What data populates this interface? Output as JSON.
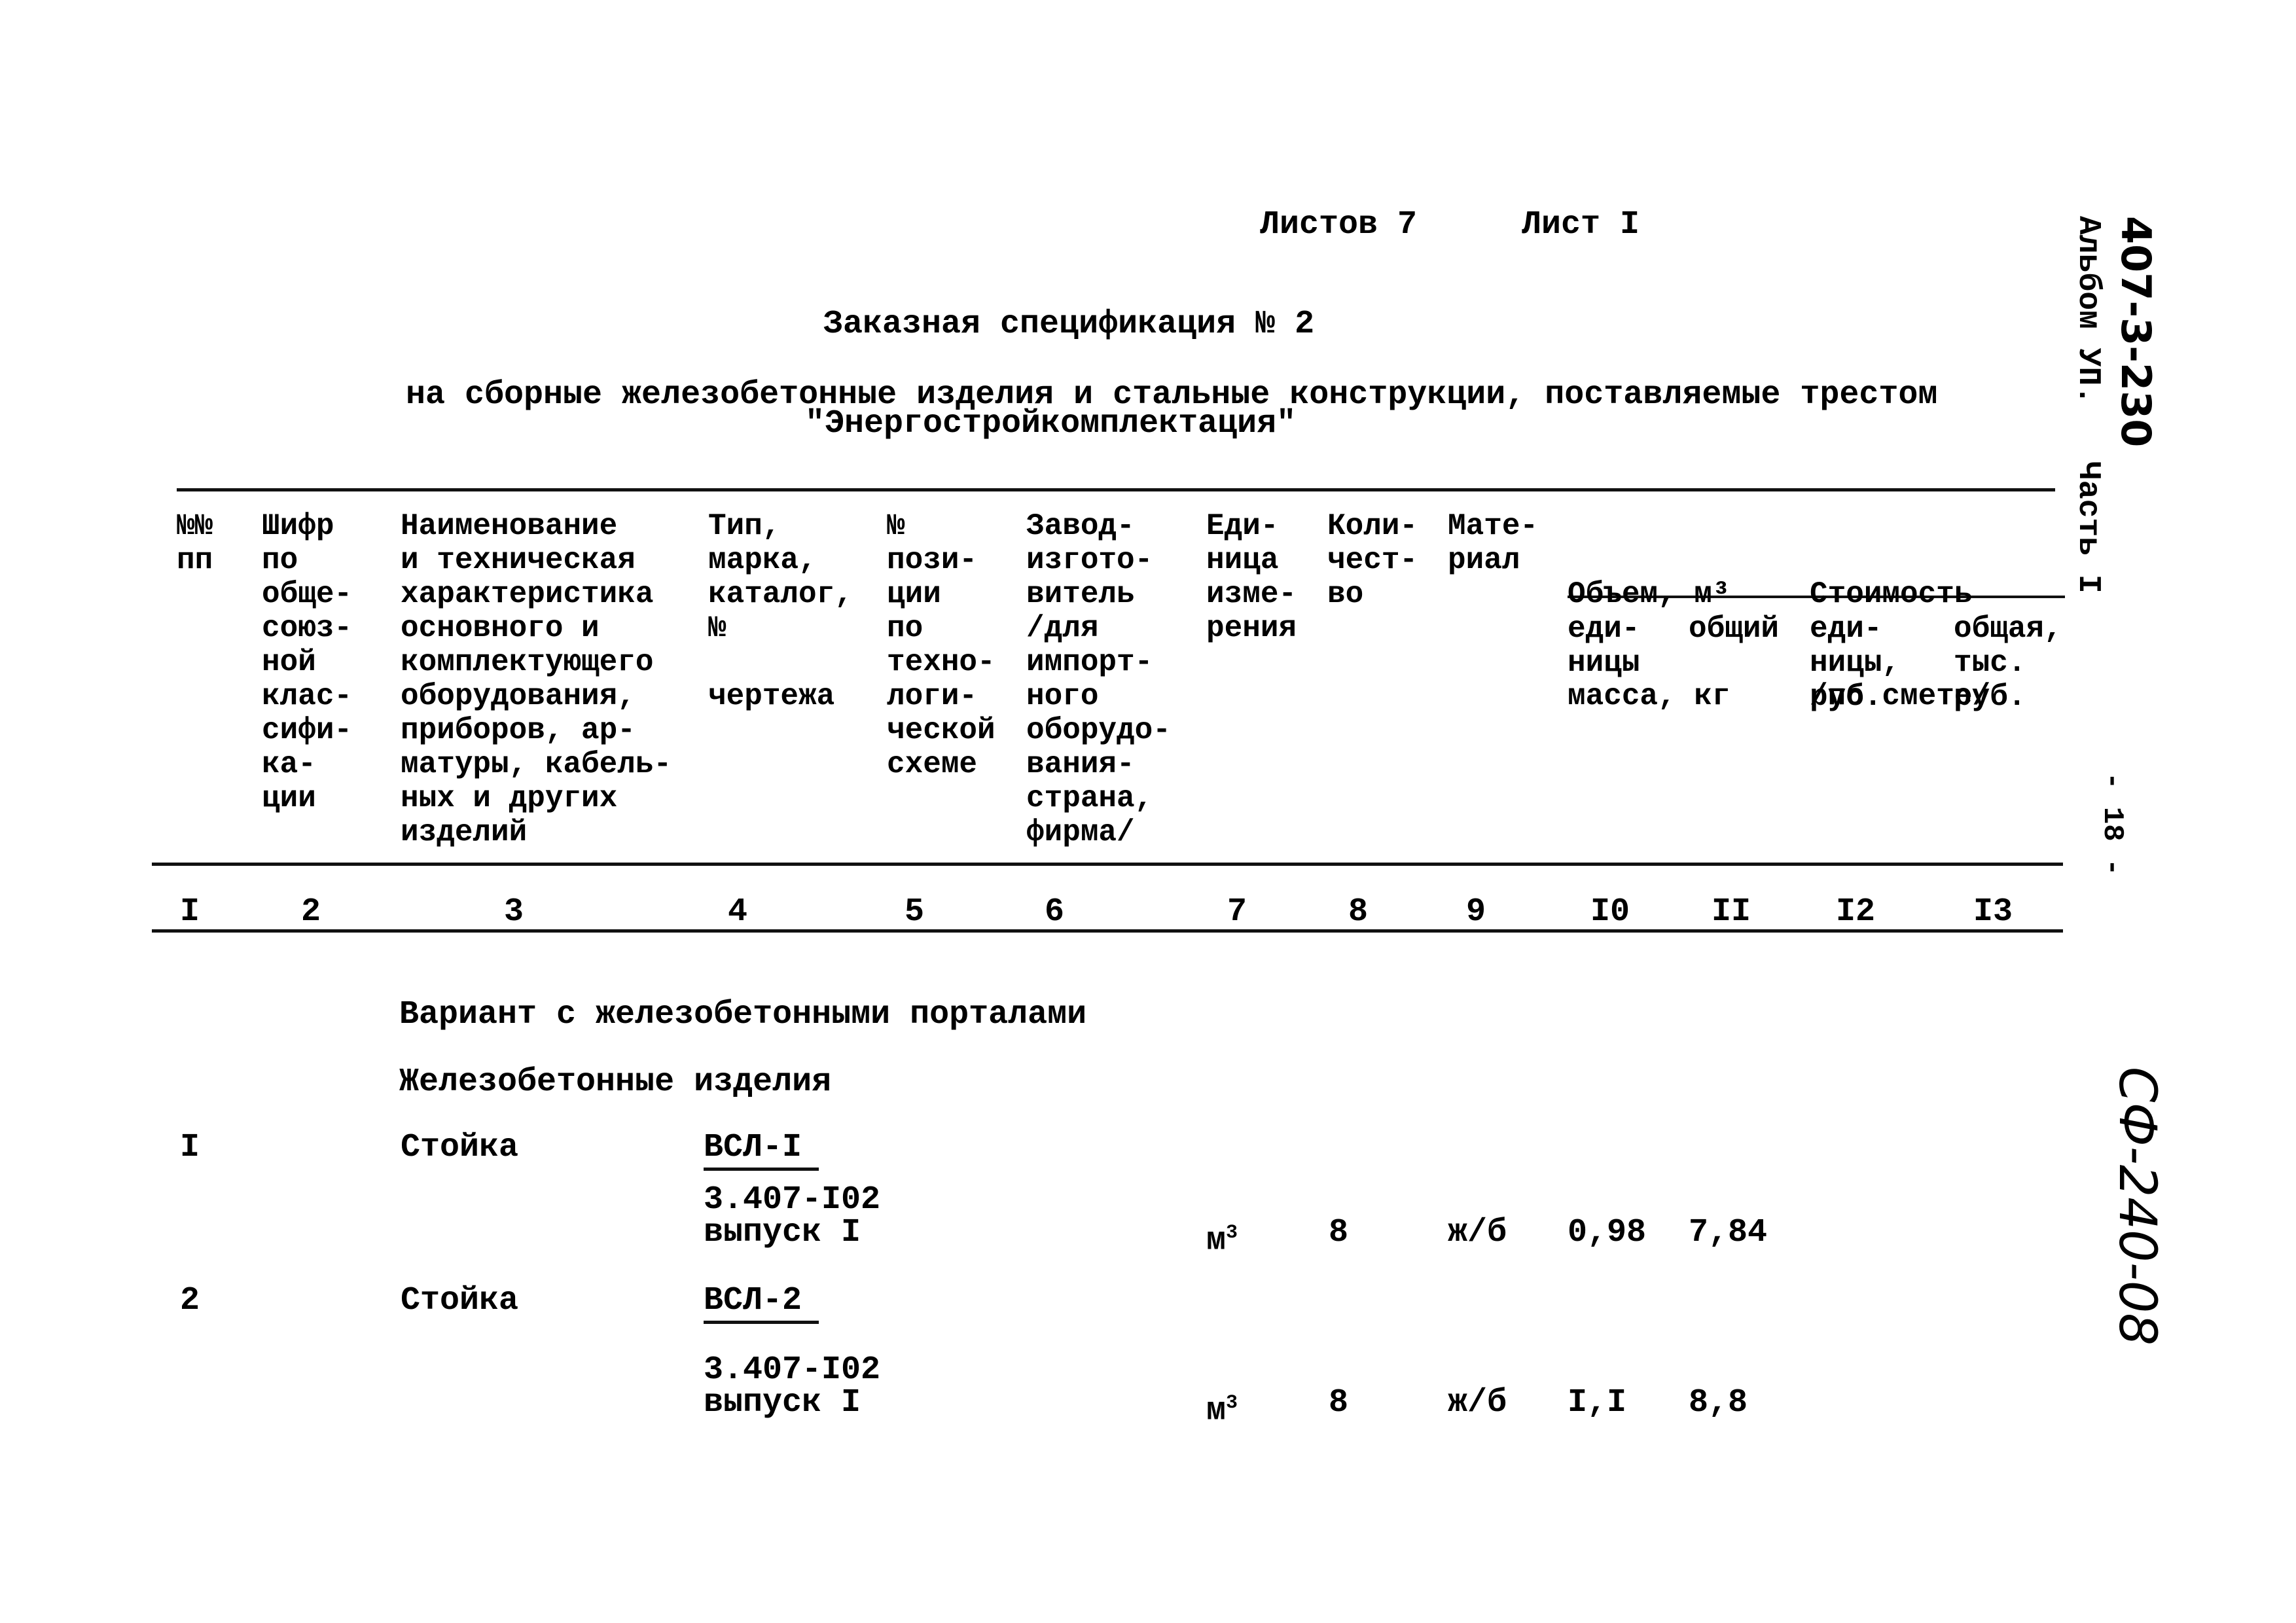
{
  "sheet": {
    "sheets_total_label": "Листов 7",
    "sheet_label": "Лист I"
  },
  "title": "Заказная спецификация № 2",
  "subtitle": {
    "line1": "на сборные железобетонные изделия и стальные конструкции, поставляемые трестом",
    "line2": "\"Энергостройкомплектация\""
  },
  "side_stamp": {
    "code": "407-3-230",
    "album": "Альбом УП.",
    "part": "Часть I",
    "page": "- 18 -",
    "doc_code": "СФ-240-08"
  },
  "table": {
    "headers": [
      {
        "lines": [
          "№№",
          "пп"
        ]
      },
      {
        "lines": [
          "Шифр",
          "по",
          "обще-",
          "союз-",
          "ной",
          "клас-",
          "сифи-",
          "ка-",
          "ции"
        ]
      },
      {
        "lines": [
          "Наименование",
          "и техническая",
          "характеристика",
          "основного и",
          "комплектующего",
          "оборудования,",
          "приборов, ар-",
          "матуры, кабель-",
          "ных и других",
          "изделий"
        ]
      },
      {
        "lines": [
          "Тип,",
          "марка,",
          "каталог,",
          "№",
          "",
          "чертежа"
        ]
      },
      {
        "lines": [
          "№",
          "пози-",
          "ции",
          "по",
          "техно-",
          "логи-",
          "ческой",
          "схеме"
        ]
      },
      {
        "lines": [
          "Завод-",
          "изгото-",
          "витель",
          "/для",
          "импорт-",
          "ного",
          "оборудо-",
          "вания-",
          "страна,",
          "фирма/"
        ]
      },
      {
        "lines": [
          "Еди-",
          "ница",
          "изме-",
          "рения"
        ]
      },
      {
        "lines": [
          "Коли-",
          "чест-",
          "во"
        ]
      },
      {
        "lines": [
          "Мате-",
          "риал"
        ]
      },
      {
        "group": "Объем, м³",
        "group_line2": "масса, кг",
        "sub": [
          [
            "еди-",
            "ницы"
          ],
          [
            "общий"
          ]
        ]
      },
      {
        "group": "Стоимость",
        "group_line2": "/по смете/",
        "sub": [
          [
            "еди-",
            "ницы,",
            "руб."
          ],
          [
            "общая,",
            "тыс.",
            "руб."
          ]
        ]
      }
    ],
    "column_numbers": [
      "I",
      "2",
      "3",
      "4",
      "5",
      "6",
      "7",
      "8",
      "9",
      "I0",
      "II",
      "I2",
      "I3"
    ],
    "section_title": "Вариант с железобетонными порталами",
    "subsection_title": "Железобетонные изделия",
    "rows": [
      {
        "num": "I",
        "name": "Стойка",
        "mark": "ВСЛ-I",
        "series": "3.407-I02",
        "issue": "выпуск I",
        "unit": "м",
        "unit_sup": "3",
        "qty": "8",
        "material": "ж/б",
        "vol_unit": "0,98",
        "vol_total": "7,84"
      },
      {
        "num": "2",
        "name": "Стойка",
        "mark": "ВСЛ-2",
        "series": "3.407-I02",
        "issue": "выпуск I",
        "unit": "м",
        "unit_sup": "3",
        "qty": "8",
        "material": "ж/б",
        "vol_unit": "I,I",
        "vol_total": "8,8"
      }
    ]
  }
}
